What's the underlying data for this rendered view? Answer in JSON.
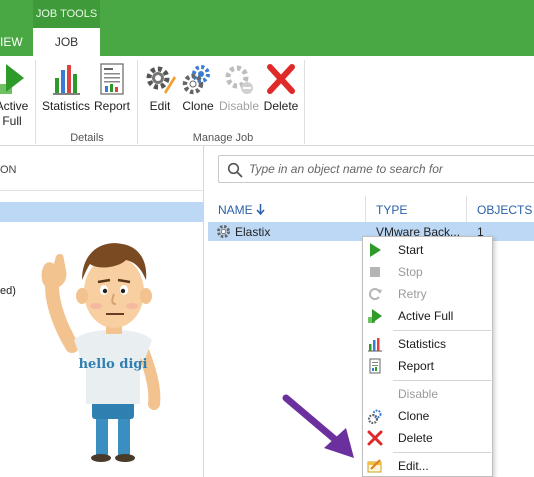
{
  "ribbon": {
    "context_tab_label": "JOB TOOLS",
    "tabs": [
      {
        "label": "IEW"
      },
      {
        "label": "JOB"
      }
    ],
    "buttons": {
      "active_full": {
        "label_line1": "Active",
        "label_line2": "Full"
      },
      "statistics": "Statistics",
      "report": "Report",
      "edit": "Edit",
      "clone": "Clone",
      "disable": "Disable",
      "delete": "Delete"
    },
    "groups": {
      "details": "Details",
      "manage_job": "Manage Job"
    }
  },
  "left_pane": {
    "header": "ON",
    "item_partial": "ed)"
  },
  "mascot": {
    "shirt_text": "hello digi"
  },
  "search": {
    "placeholder": "Type in an object name to search for"
  },
  "table": {
    "columns": [
      {
        "label": "NAME",
        "sort": "descending"
      },
      {
        "label": "TYPE"
      },
      {
        "label": "OBJECTS"
      }
    ],
    "rows": [
      {
        "name": "Elastix",
        "type": "VMware Back...",
        "objects": "1"
      }
    ]
  },
  "context_menu": {
    "items": [
      {
        "label": "Start",
        "icon": "play-icon",
        "enabled": true
      },
      {
        "label": "Stop",
        "icon": "stop-icon",
        "enabled": false
      },
      {
        "label": "Retry",
        "icon": "retry-icon",
        "enabled": false
      },
      {
        "label": "Active Full",
        "icon": "active-full-icon",
        "enabled": true
      },
      {
        "label": "Statistics",
        "icon": "statistics-icon",
        "enabled": true
      },
      {
        "label": "Report",
        "icon": "report-icon",
        "enabled": true
      },
      {
        "label": "Disable",
        "icon": "disable-icon",
        "enabled": false
      },
      {
        "label": "Clone",
        "icon": "clone-icon",
        "enabled": true
      },
      {
        "label": "Delete",
        "icon": "delete-icon",
        "enabled": true
      },
      {
        "label": "Edit...",
        "icon": "edit-icon",
        "enabled": true
      }
    ]
  },
  "colors": {
    "ribbon_green": "#4aa844",
    "selection_blue": "#bcd8f5",
    "header_blue": "#2a5fa8",
    "arrow_purple": "#6b2f9e",
    "delete_red": "#e02a2a"
  }
}
